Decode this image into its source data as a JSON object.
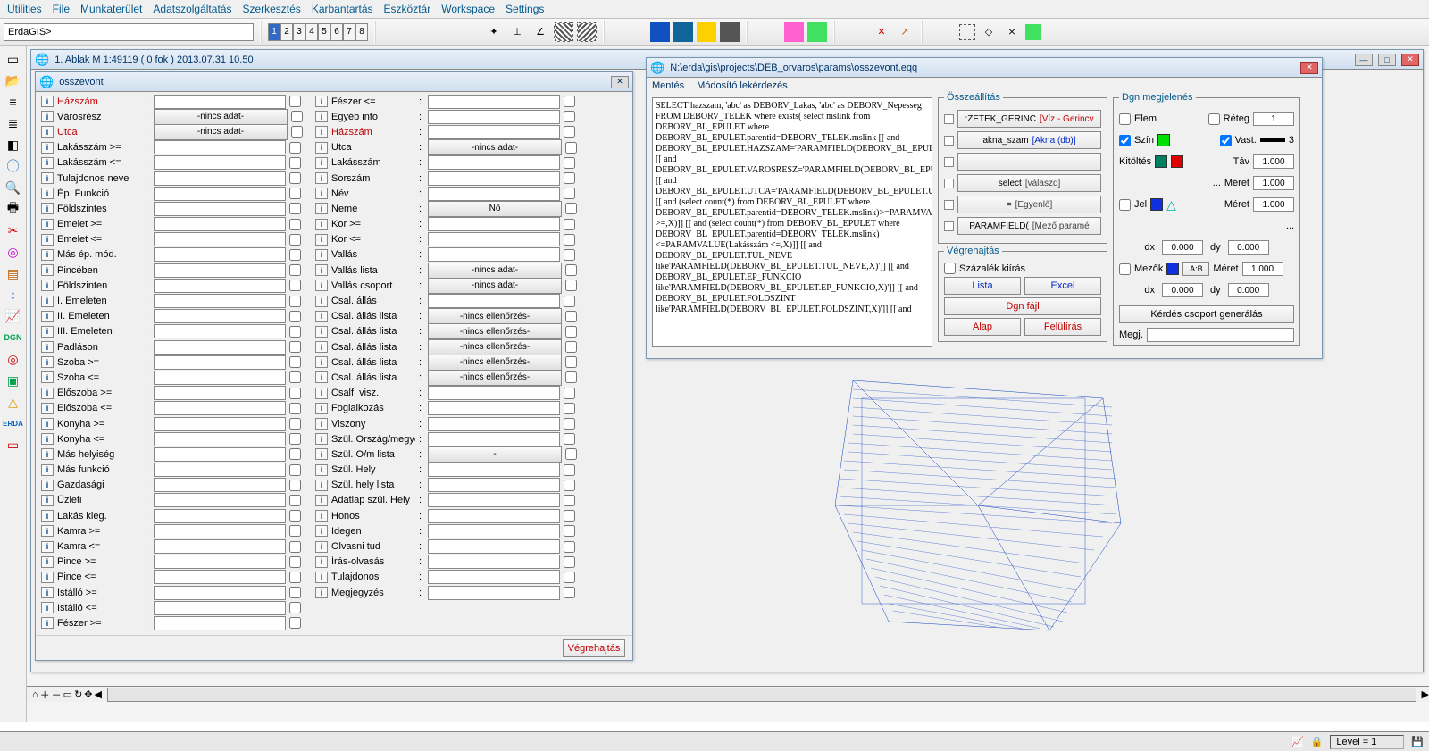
{
  "menu": [
    "Utilities",
    "File",
    "Munkaterület",
    "Adatszolgáltatás",
    "Szerkesztés",
    "Karbantartás",
    "Eszköztár",
    "Workspace",
    "Settings"
  ],
  "command_prompt": "ErdaGIS>",
  "pages": [
    "1",
    "2",
    "3",
    "4",
    "5",
    "6",
    "7",
    "8"
  ],
  "active_page": "1",
  "mdi_main_title": "1. Ablak  M 1:49119   ( 0 fok )  2013.07.31 10.50",
  "osszevont": {
    "title": "osszevont",
    "vegrehajtas": "Végrehajtás",
    "nincs_adat": "-nincs adat-",
    "nincs_ell": "-nincs ellenőrzés-",
    "no": "Nő",
    "dash": "-",
    "col1": [
      {
        "l": "Házszám",
        "red": true,
        "t": "input"
      },
      {
        "l": "Városrész",
        "t": "select",
        "sel": "nincs_adat"
      },
      {
        "l": "Utca",
        "red": true,
        "t": "select",
        "sel": "nincs_adat"
      },
      {
        "l": "Lakásszám >=",
        "t": "input"
      },
      {
        "l": "Lakásszám <=",
        "t": "input"
      },
      {
        "l": "Tulajdonos neve",
        "t": "input"
      },
      {
        "l": "Ép. Funkció",
        "t": "input"
      },
      {
        "l": "Földszintes",
        "t": "input"
      },
      {
        "l": "Emelet >=",
        "t": "input"
      },
      {
        "l": "Emelet <=",
        "t": "input"
      },
      {
        "l": "Más ép. mód.",
        "t": "input"
      },
      {
        "l": "Pincében",
        "t": "input"
      },
      {
        "l": "Földszinten",
        "t": "input"
      },
      {
        "l": "I. Emeleten",
        "t": "input"
      },
      {
        "l": "II. Emeleten",
        "t": "input"
      },
      {
        "l": "III. Emeleten",
        "t": "input"
      },
      {
        "l": "Padláson",
        "t": "input"
      },
      {
        "l": "Szoba >=",
        "t": "input"
      },
      {
        "l": "Szoba <=",
        "t": "input"
      },
      {
        "l": "Előszoba >=",
        "t": "input"
      },
      {
        "l": "Előszoba <=",
        "t": "input"
      },
      {
        "l": "Konyha >=",
        "t": "input"
      },
      {
        "l": "Konyha <=",
        "t": "input"
      },
      {
        "l": "Más helyiség",
        "t": "input"
      },
      {
        "l": "Más funkció",
        "t": "input"
      },
      {
        "l": "Gazdasági",
        "t": "input"
      },
      {
        "l": "Üzleti",
        "t": "input"
      },
      {
        "l": "Lakás kieg.",
        "t": "input"
      },
      {
        "l": "Kamra >=",
        "t": "input"
      },
      {
        "l": "Kamra <=",
        "t": "input"
      },
      {
        "l": "Pince >=",
        "t": "input"
      },
      {
        "l": "Pince <=",
        "t": "input"
      },
      {
        "l": "Istálló >=",
        "t": "input"
      },
      {
        "l": "Istálló <=",
        "t": "input"
      },
      {
        "l": "Fészer >=",
        "t": "input"
      }
    ],
    "col2": [
      {
        "l": "Fészer <=",
        "t": "input"
      },
      {
        "l": "Egyéb info",
        "t": "input"
      },
      {
        "l": "Házszám",
        "red": true,
        "t": "input"
      },
      {
        "l": "Utca",
        "t": "select",
        "sel": "nincs_adat"
      },
      {
        "l": "Lakásszám",
        "t": "input"
      },
      {
        "l": "Sorszám",
        "t": "input"
      },
      {
        "l": "Név",
        "t": "input"
      },
      {
        "l": "Neme",
        "t": "select",
        "sel": "no"
      },
      {
        "l": "Kor >=",
        "t": "input"
      },
      {
        "l": "Kor <=",
        "t": "input"
      },
      {
        "l": "Vallás",
        "t": "input"
      },
      {
        "l": "Vallás lista",
        "t": "select",
        "sel": "nincs_adat"
      },
      {
        "l": "Vallás csoport",
        "t": "select",
        "sel": "nincs_adat"
      },
      {
        "l": "Csal. állás",
        "t": "input"
      },
      {
        "l": "Csal. állás lista",
        "t": "select",
        "sel": "nincs_ell"
      },
      {
        "l": "Csal. állás lista",
        "t": "select",
        "sel": "nincs_ell"
      },
      {
        "l": "Csal. állás lista",
        "t": "select",
        "sel": "nincs_ell"
      },
      {
        "l": "Csal. állás lista",
        "t": "select",
        "sel": "nincs_ell"
      },
      {
        "l": "Csal. állás lista",
        "t": "select",
        "sel": "nincs_ell"
      },
      {
        "l": "Csalf. visz.",
        "t": "input"
      },
      {
        "l": "Foglalkozás",
        "t": "input"
      },
      {
        "l": "Viszony",
        "t": "input"
      },
      {
        "l": "Szül. Ország/megye",
        "t": "input"
      },
      {
        "l": "Szül. O/m lista",
        "t": "select",
        "sel": "dash"
      },
      {
        "l": "Szül. Hely",
        "t": "input"
      },
      {
        "l": "Szül. hely lista",
        "t": "input"
      },
      {
        "l": "Adatlap szül. Hely",
        "t": "input"
      },
      {
        "l": "Honos",
        "t": "input"
      },
      {
        "l": "Idegen",
        "t": "input"
      },
      {
        "l": "Olvasni tud",
        "t": "input"
      },
      {
        "l": "Írás-olvasás",
        "t": "input"
      },
      {
        "l": "Tulajdonos",
        "t": "input"
      },
      {
        "l": "Megjegyzés",
        "t": "input"
      }
    ]
  },
  "query": {
    "title": "N:\\erda\\gis\\projects\\DEB_orvaros\\params\\osszevont.eqq",
    "menu": [
      "Mentés",
      "Módosító lekérdezés"
    ],
    "sql": "SELECT hazszam, 'abc' as DEBORV_Lakas, 'abc' as DEBORV_Nepesseg FROM DEBORV_TELEK where exists( select mslink from DEBORV_BL_EPULET where DEBORV_BL_EPULET.parentid=DEBORV_TELEK.mslink [[ and DEBORV_BL_EPULET.HAZSZAM='PARAMFIELD(DEBORV_BL_EPULET.HAZSZAM,X)']] [[ and DEBORV_BL_EPULET.VAROSRESZ='PARAMFIELD(DEBORV_BL_EPULET.VAROSRESZ,X)]] [[ and DEBORV_BL_EPULET.UTCA='PARAMFIELD(DEBORV_BL_EPULET.UTCA,X]]) [[ and (select count(*) from DEBORV_BL_EPULET where DEBORV_BL_EPULET.parentid=DEBORV_TELEK.mslink)>=PARAMVALUE(Lakásszám >=,X)]] [[ and (select count(*) from DEBORV_BL_EPULET where DEBORV_BL_EPULET.parentid=DEBORV_TELEK.mslink)<=PARAMVALUE(Lakásszám <=,X)]] [[ and DEBORV_BL_EPULET.TUL_NEVE like'PARAMFIELD(DEBORV_BL_EPULET.TUL_NEVE,X)']] [[ and DEBORV_BL_EPULET.EP_FUNKCIO like'PARAMFIELD(DEBORV_BL_EPULET.EP_FUNKCIO,X)']] [[ and DEBORV_BL_EPULET.FOLDSZINT like'PARAMFIELD(DEBORV_BL_EPULET.FOLDSZINT,X)']] [[ and",
    "osszeallitas": "Összeállítás",
    "rows": [
      {
        "main": ":ZETEK_GERINC",
        "tag": "[Víz - Gerincv",
        "tagcls": "red"
      },
      {
        "main": "akna_szam",
        "tag": "[Akna (db)]",
        "tagcls": "blue"
      },
      {
        "main": "",
        "tag": ""
      },
      {
        "main": "select",
        "tag": "[válaszd]"
      },
      {
        "main": "=",
        "tag": "[Egyenlő]"
      },
      {
        "main": "PARAMFIELD(",
        "tag": "[Mező paramé"
      }
    ],
    "vegrehajtas": "Végrehajtás",
    "szazalek": "Százalék kiírás",
    "lista": "Lista",
    "excel": "Excel",
    "dgnfajl": "Dgn fájl",
    "alap": "Alap",
    "felul": "Felülírás",
    "dgn": {
      "title": "Dgn megjelenés",
      "elem": "Elem",
      "reteg": "Réteg",
      "reteg_v": "1",
      "szin": "Szín",
      "vast": "Vast.",
      "vast_v": "3",
      "kitoltes": "Kitöltés",
      "tav": "Táv",
      "tav_v": "1.000",
      "ellipsis": "...",
      "meret": "Méret",
      "meret_v": "1.000",
      "jel": "Jel",
      "dx": "dx",
      "dx_v": "0.000",
      "dy": "dy",
      "dy_v": "0.000",
      "mezok": "Mezők",
      "ab": "A:B",
      "gen": "Kérdés csoport generálás",
      "megj": "Megj."
    }
  },
  "status": {
    "level": "Level = 1",
    "lock": "🔒"
  }
}
